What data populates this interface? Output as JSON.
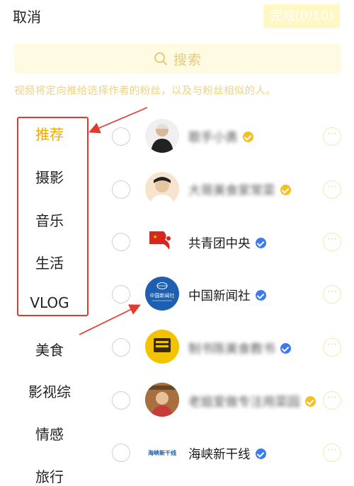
{
  "header": {
    "cancel_label": "取消",
    "done_label": "完成(0/10)"
  },
  "search": {
    "placeholder": "搜索",
    "icon": "search-icon"
  },
  "hint": "视频将定向推给选择作者的粉丝，以及与粉丝相似的人。",
  "categories": [
    "推荐",
    "摄影",
    "音乐",
    "生活",
    "VLOG",
    "美食",
    "影视综",
    "情感",
    "旅行"
  ],
  "active_category": "推荐",
  "colors": {
    "accent": "#f3a900",
    "verified_blue": "#3a7bf5",
    "verified_gold": "#f5c022",
    "annotation_red": "#e33a2e"
  },
  "authors": [
    {
      "name": "歌手小勇",
      "badge": "gold"
    },
    {
      "name": "大哥美食家常菜",
      "badge": "gold"
    },
    {
      "name": "共青团中央",
      "badge": "blue"
    },
    {
      "name": "中国新闻社",
      "badge": "blue",
      "avatar_text": "中国新闻社"
    },
    {
      "name": "制书陈美食教书",
      "badge": "blue"
    },
    {
      "name": "老姐爱做专注用菜园",
      "badge": "gold"
    },
    {
      "name": "海峡新干线",
      "badge": "blue",
      "avatar_text": "海峡新干线"
    }
  ]
}
